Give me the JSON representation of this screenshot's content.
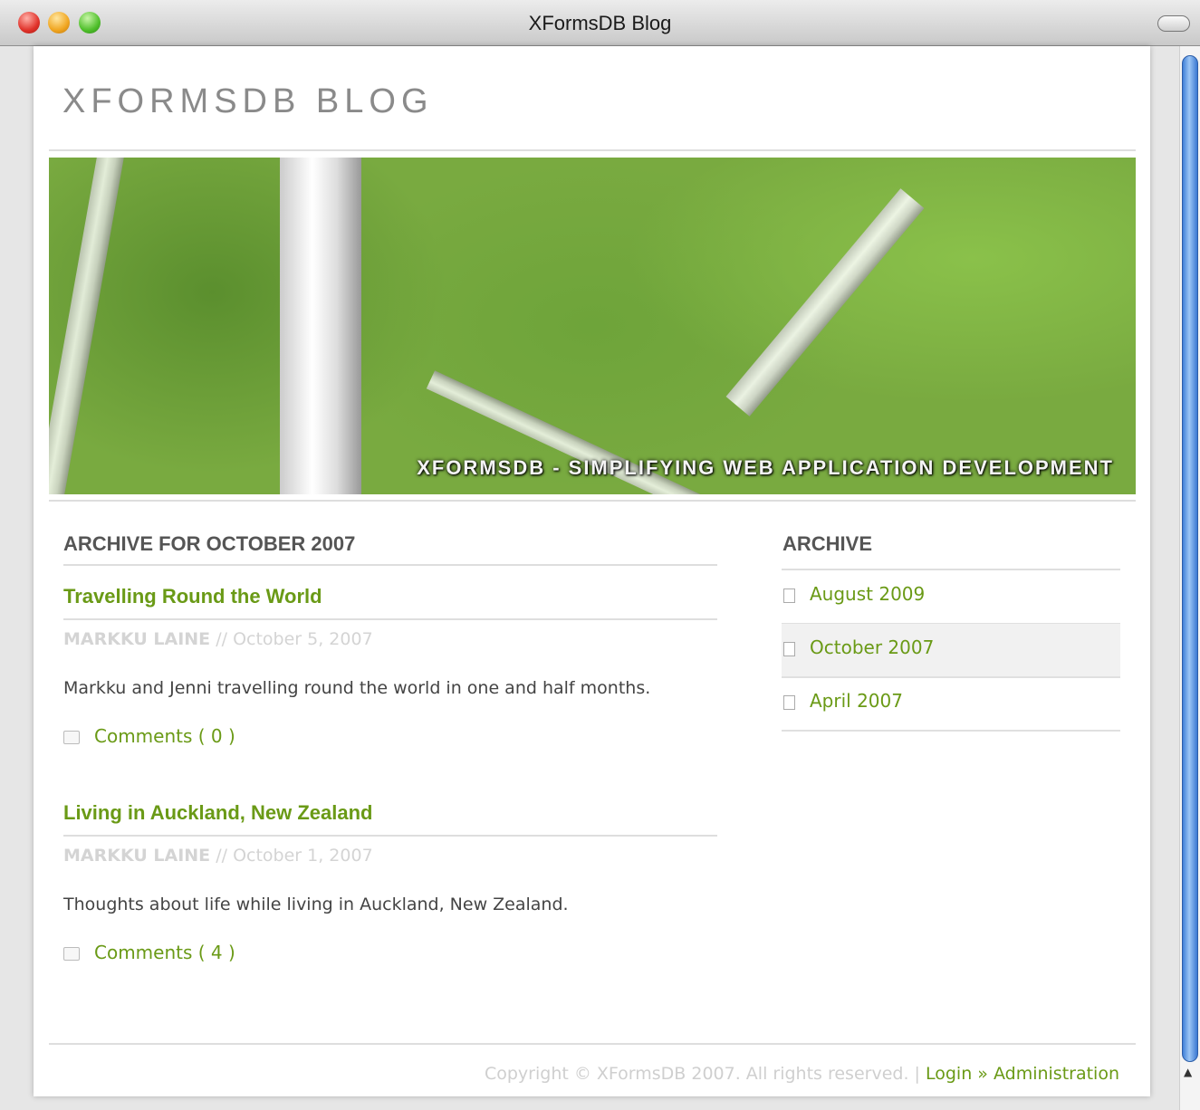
{
  "window": {
    "title": "XFormsDB Blog"
  },
  "site": {
    "title": "XFORMSDB BLOG",
    "tagline": "XFORMSDB - SIMPLIFYING WEB APPLICATION DEVELOPMENT"
  },
  "main": {
    "heading": "ARCHIVE FOR OCTOBER 2007",
    "posts": [
      {
        "title": "Travelling Round the World",
        "author": "MARKKU LAINE",
        "separator": " // ",
        "date": "October 5, 2007",
        "excerpt": "Markku and Jenni travelling round the world in one and half months.",
        "comments_label": "Comments ( 0 )"
      },
      {
        "title": "Living in Auckland, New Zealand",
        "author": "MARKKU LAINE",
        "separator": " // ",
        "date": "October 1, 2007",
        "excerpt": "Thoughts about life while living in Auckland, New Zealand.",
        "comments_label": "Comments ( 4 )"
      }
    ]
  },
  "sidebar": {
    "heading": "ARCHIVE",
    "items": [
      {
        "label": "August 2009"
      },
      {
        "label": "October 2007"
      },
      {
        "label": "April 2007"
      }
    ]
  },
  "footer": {
    "copyright": "Copyright © XFormsDB 2007. All rights reserved.",
    "divider": " | ",
    "login": "Login",
    "arrow": " » ",
    "admin": "Administration"
  }
}
